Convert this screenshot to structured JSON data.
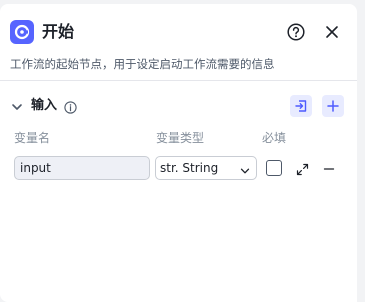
{
  "header": {
    "title": "开始",
    "icon": "start-node-icon",
    "accent_color": "#5664ff"
  },
  "description": "工作流的起始节点，用于设定启动工作流需要的信息",
  "inputs_section": {
    "title": "输入",
    "columns": [
      "变量名",
      "变量类型",
      "必填"
    ],
    "rows": [
      {
        "name": "input",
        "type": "str. String",
        "required": false
      }
    ]
  }
}
